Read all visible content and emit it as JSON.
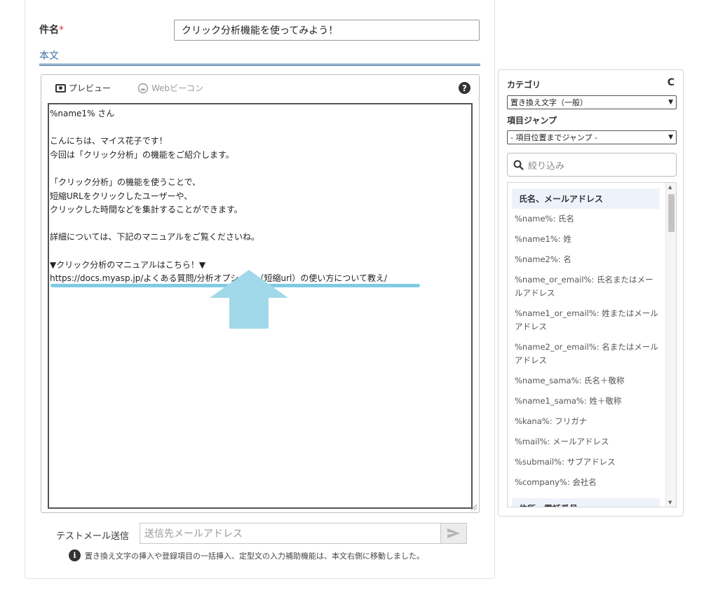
{
  "subject": {
    "label": "件名",
    "required_mark": "*",
    "value": "クリック分析機能を使ってみよう！"
  },
  "body_section": {
    "label": "本文"
  },
  "toolbar": {
    "preview_label": "プレビュー",
    "beacon_label": "Webビーコン",
    "help_glyph": "?"
  },
  "editor": {
    "lines": [
      "%name1% さん",
      "",
      "こんにちは、マイス花子です！",
      "今回は「クリック分析」の機能をご紹介します。",
      "",
      "「クリック分析」の機能を使うことで、",
      "短縮URLをクリックしたユーザーや、",
      "クリックした時間などを集計することができます。",
      "",
      "詳細については、下記のマニュアルをご覧くださいね。",
      "",
      "▼クリック分析のマニュアルはこちら！▼",
      "https://docs.myasp.jp/よくある質問/分析オプション（短縮url）の使い方について教え/"
    ]
  },
  "test_mail": {
    "label": "テストメール送信",
    "placeholder": "送信先メールアドレス"
  },
  "info": {
    "glyph": "i",
    "text": "置き換え文字の挿入や登録項目の一括挿入、定型文の入力補助機能は、本文右側に移動しました。"
  },
  "sidebar": {
    "category_label": "カテゴリ",
    "refresh_glyph": "C",
    "category_selected": "置き換え文字（一般）",
    "jump_label": "項目ジャンプ",
    "jump_selected": "- 項目位置までジャンプ -",
    "filter_placeholder": "絞り込み",
    "group_header": "氏名、メールアドレス",
    "items": [
      "%name%: 氏名",
      "%name1%: 姓",
      "%name2%: 名",
      "%name_or_email%: 氏名またはメールアドレス",
      "%name1_or_email%: 姓またはメールアドレス",
      "%name2_or_email%: 名またはメールアドレス",
      "%name_sama%: 氏名＋敬称",
      "%name1_sama%: 姓＋敬称",
      "%kana%: フリガナ",
      "%mail%: メールアドレス",
      "%submail%: サブアドレス",
      "%company%: 会社名"
    ],
    "next_group_header": "住所、電話番号"
  },
  "colors": {
    "accent_blue": "#3b6ea5",
    "highlight_cyan": "#7ecbe3",
    "required_red": "#e0304a"
  }
}
